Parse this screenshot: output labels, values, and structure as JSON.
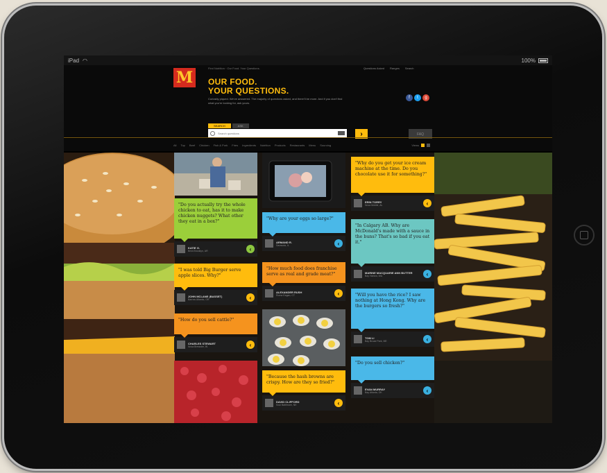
{
  "device": {
    "carrier": "iPad",
    "battery": "100%"
  },
  "brand": {
    "logo_letter": "M",
    "colors": {
      "yellow": "#ffbc0d",
      "red": "#d52b1e",
      "green": "#9bcf3a",
      "blue": "#4ab8e8",
      "orange": "#f5931e",
      "teal": "#6cc7c2"
    }
  },
  "header": {
    "top_nav_text": "Find Nutrition · Our Food. Your Questions.",
    "top_links": [
      "Questions Asked",
      "Ranges",
      "Search"
    ],
    "headline_1": "OUR FOOD.",
    "headline_2": "YOUR QUESTIONS.",
    "intro": "Curiosity piqued. We've answered. The majority of questions asked, and there'll be more. And if you don't find what you're looking for, ask yours.",
    "social": [
      "f",
      "t",
      "g"
    ],
    "tabs": [
      "SEARCH",
      "ASK"
    ],
    "search_placeholder": "Search questions",
    "search_go": "›",
    "faq_button": "FAQ"
  },
  "category_nav": {
    "items": [
      "All",
      "Top",
      "Beef",
      "Chicken",
      "Fish & Pork",
      "Fries",
      "Ingredients",
      "Nutrition",
      "Products",
      "Restaurants",
      "Menu",
      "Sourcing"
    ],
    "view_label": "Views"
  },
  "columns": [
    [
      {
        "kind": "photo",
        "name": "farmer-photo"
      },
      {
        "kind": "question",
        "color": "g",
        "share": "g",
        "text": "\"Do you actually try the whole chicken to eat, has it to make chicken nuggets? What other they eat in a box?\"",
        "author": "KATIE G.",
        "location": "Brea Brooklyn, AR"
      },
      {
        "kind": "question",
        "color": "y",
        "share": "y",
        "text": "\"I was told Big Burger serve apple slices. Why?\"",
        "author": "JOHN MCLANE (BASSET)",
        "location": "Barrow Atlantic, OR"
      },
      {
        "kind": "question",
        "color": "o",
        "share": "y",
        "text": "\"How do you sell cattle?\"",
        "author": "CHARLES STEWART",
        "location": "Nova Brewster, IN"
      },
      {
        "kind": "photo",
        "name": "ground-beef-photo"
      }
    ],
    [
      {
        "kind": "photo",
        "name": "tablet-video-photo"
      },
      {
        "kind": "question",
        "color": "bl",
        "share": "b",
        "text": "\"Why are your eggs so large?\"",
        "author": "ARMAND R.",
        "location": "Sarasota, IL"
      },
      {
        "kind": "question",
        "color": "o",
        "share": "y",
        "text": "\"How much food does franchise serve as real and grade meat?\"",
        "author": "ALEXANDER RUSH",
        "location": "Roma Eagan, CT"
      },
      {
        "kind": "photo",
        "name": "eggs-photo"
      },
      {
        "kind": "question",
        "color": "y",
        "share": "y",
        "text": "\"Because the hash browns are crispy. How are they so fried?\"",
        "author": "DAVID CLIFFORD",
        "location": "Soul Baltimore, NE"
      }
    ],
    [
      {
        "kind": "question",
        "color": "y",
        "share": "y",
        "text": "\"Why do you get your ice cream machine at the time. Do you chocolate use it for something?\"",
        "author": "ERIN TORRY",
        "location": "Nova Mobile, AL"
      },
      {
        "kind": "question",
        "color": "tq",
        "share": "b",
        "text": "\"In Calgary AB. Why are McDonald's made with a sauce in the buns? That's so bad if you eat it.\"",
        "author": "MARINE MACQUARIE ANN BUTTER",
        "location": "Bay Harlow, WA"
      },
      {
        "kind": "question",
        "color": "bl",
        "share": "b",
        "text": "\"Will you have the rice? I saw nothing at Hong Kong. Why are the burgers so fresh?\"",
        "author": "TOM LI",
        "location": "Bay Broad Park, ME"
      },
      {
        "kind": "question",
        "color": "bl",
        "share": "b",
        "text": "\"Do you sell chicken?\"",
        "author": "EVAN MURRAY",
        "location": "Bay Atlanta, OK"
      }
    ]
  ]
}
